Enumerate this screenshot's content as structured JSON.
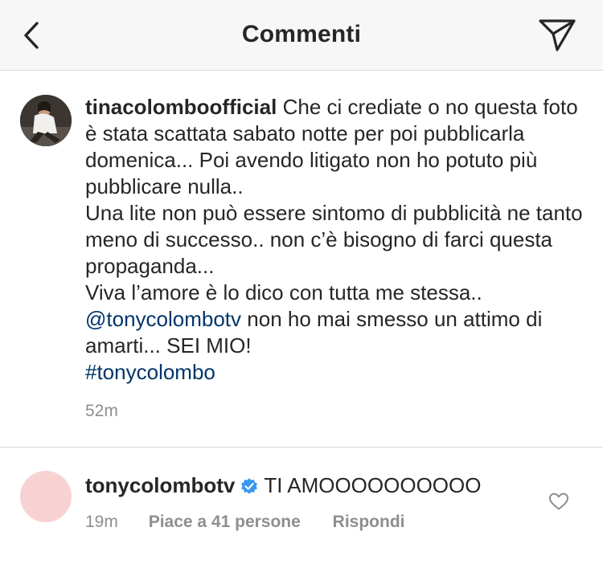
{
  "header": {
    "title": "Commenti",
    "back_icon": "chevron-left-icon",
    "share_icon": "paper-plane-icon"
  },
  "caption": {
    "username": "tinacolomboofficial",
    "para1": "Che ci crediate o no questa foto è stata scattata sabato notte per poi pubblicarla domenica... Poi avendo litigato non ho potuto più pubblicare nulla..",
    "para2": "Una lite non può essere sintomo di pubblicità ne tanto meno di successo.. non c’è bisogno di farci questa propaganda...",
    "para3_text": "Viva l’amore è lo dico con tutta me stessa..",
    "mention": "@tonycolombotv",
    "para3_after": "non ho mai smesso un attimo di amarti... SEI MIO!",
    "hashtag": "#tonycolombo",
    "time": "52m"
  },
  "reply": {
    "username": "tonycolombotv",
    "verified_icon": "verified-badge-icon",
    "text": "TI AMOOOOOOOOOO",
    "time": "19m",
    "likes": "Piace a 41 persone",
    "reply_label": "Rispondi",
    "like_icon": "heart-outline-icon"
  },
  "colors": {
    "link": "#003569",
    "secondary_text": "#8e8e8e",
    "verified": "#3897f0",
    "header_bg": "#f7f7f7"
  }
}
